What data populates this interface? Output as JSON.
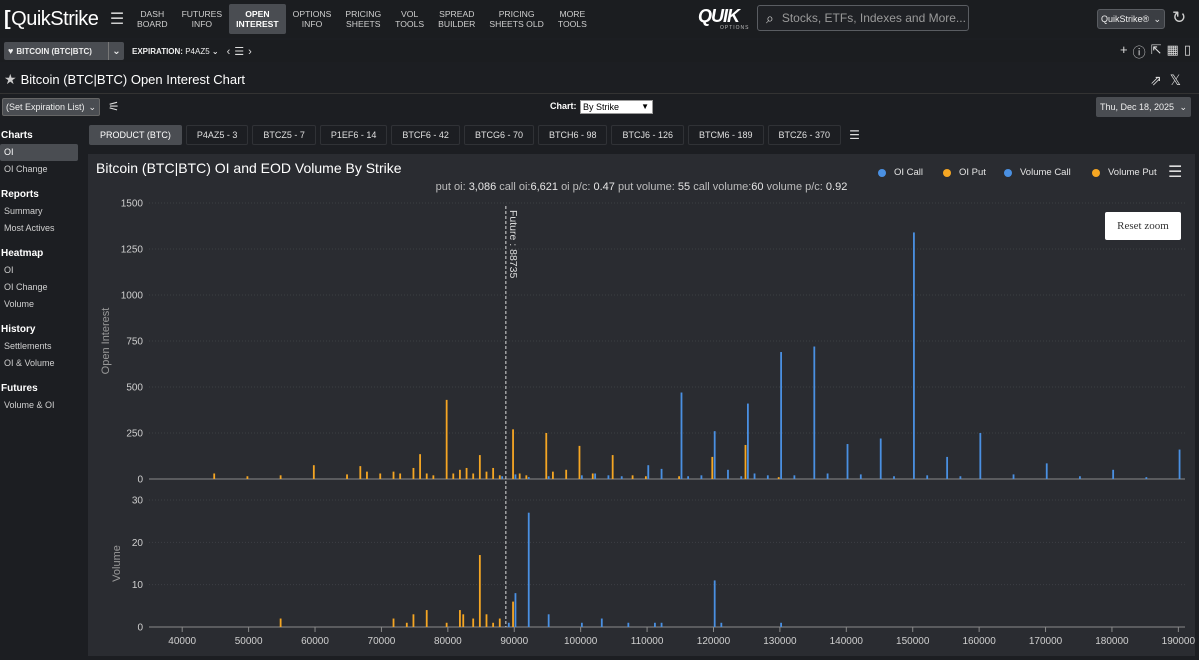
{
  "app": {
    "logo": "QuikStrike",
    "nav": [
      {
        "line1": "DASH",
        "line2": "BOARD"
      },
      {
        "line1": "FUTURES",
        "line2": "INFO"
      },
      {
        "line1": "OPEN",
        "line2": "INTEREST"
      },
      {
        "line1": "OPTIONS",
        "line2": "INFO"
      },
      {
        "line1": "PRICING",
        "line2": "SHEETS"
      },
      {
        "line1": "VOL",
        "line2": "TOOLS"
      },
      {
        "line1": "SPREAD",
        "line2": "BUILDER"
      },
      {
        "line1": "PRICING",
        "line2": "SHEETS OLD"
      },
      {
        "line1": "MORE",
        "line2": "TOOLS"
      }
    ],
    "active_nav_index": 2,
    "brand_logo": "QUIK",
    "brand_logo_sub": "OPTIONS",
    "search_placeholder": "Stocks, ETFs, Indexes and More...",
    "user_menu": "QuikStrike®"
  },
  "subbar": {
    "product": "BITCOIN (BTC|BTC)",
    "expiration_label": "EXPIRATION:",
    "expiration_value": "P4AZ5"
  },
  "page": {
    "title": "Bitcoin (BTC|BTC) Open Interest Chart"
  },
  "controls": {
    "expiration_list": "(Set Expiration List)",
    "chart_label": "Chart:",
    "chart_value": "By Strike",
    "date": "Thu, Dec 18, 2025"
  },
  "sidebar": [
    {
      "heading": "Charts",
      "items": [
        "OI",
        "OI Change"
      ]
    },
    {
      "heading": "Reports",
      "items": [
        "Summary",
        "Most Actives"
      ]
    },
    {
      "heading": "Heatmap",
      "items": [
        "OI",
        "OI Change",
        "Volume"
      ]
    },
    {
      "heading": "History",
      "items": [
        "Settlements",
        "OI & Volume"
      ]
    },
    {
      "heading": "Futures",
      "items": [
        "Volume & OI"
      ]
    }
  ],
  "tabs": [
    "PRODUCT (BTC)",
    "P4AZ5 - 3",
    "BTCZ5 - 7",
    "P1EF6 - 14",
    "BTCF6 - 42",
    "BTCG6 - 70",
    "BTCH6 - 98",
    "BTCJ6 - 126",
    "BTCM6 - 189",
    "BTCZ6 - 370"
  ],
  "chart_panel": {
    "reset_zoom": "Reset zoom",
    "stats": {
      "put_oi_label": "put oi:",
      "put_oi": "3,086",
      "call_oi_label": "call oi:",
      "call_oi": "6,621",
      "oi_pc_label": "oi p/c:",
      "oi_pc": "0.47",
      "put_vol_label": "put volume:",
      "put_vol": "55",
      "call_vol_label": "call volume:",
      "call_vol": "60",
      "vol_pc_label": "volume p/c:",
      "vol_pc": "0.92"
    }
  },
  "chart_data": {
    "type": "bar",
    "title": "Bitcoin (BTC|BTC) OI and EOD Volume By Strike",
    "legend": [
      {
        "name": "OI Call",
        "color": "#4a90e2"
      },
      {
        "name": "OI Put",
        "color": "#f5a623"
      },
      {
        "name": "Volume Call",
        "color": "#4a90e2"
      },
      {
        "name": "Volume Put",
        "color": "#f5a623"
      }
    ],
    "legend_placement": "top-right",
    "xlim": [
      35000,
      191000
    ],
    "xticks": [
      40000,
      50000,
      60000,
      70000,
      80000,
      90000,
      100000,
      110000,
      120000,
      130000,
      140000,
      150000,
      160000,
      170000,
      180000,
      190000
    ],
    "future_line": {
      "x": 88735,
      "label": "Future : 88735"
    },
    "oi_panel": {
      "ylabel": "Open Interest",
      "ylim": [
        0,
        1500
      ],
      "yticks": [
        0,
        250,
        500,
        750,
        1000,
        1250,
        1500
      ],
      "put": [
        [
          45000,
          30
        ],
        [
          50000,
          15
        ],
        [
          55000,
          20
        ],
        [
          60000,
          75
        ],
        [
          65000,
          25
        ],
        [
          67000,
          70
        ],
        [
          68000,
          40
        ],
        [
          70000,
          30
        ],
        [
          72000,
          40
        ],
        [
          73000,
          30
        ],
        [
          75000,
          60
        ],
        [
          76000,
          135
        ],
        [
          77000,
          30
        ],
        [
          78000,
          20
        ],
        [
          80000,
          430
        ],
        [
          81000,
          30
        ],
        [
          82000,
          50
        ],
        [
          83000,
          60
        ],
        [
          84000,
          30
        ],
        [
          85000,
          130
        ],
        [
          86000,
          40
        ],
        [
          87000,
          60
        ],
        [
          88000,
          20
        ],
        [
          90000,
          270
        ],
        [
          91000,
          30
        ],
        [
          92000,
          20
        ],
        [
          95000,
          250
        ],
        [
          96000,
          40
        ],
        [
          98000,
          50
        ],
        [
          100000,
          180
        ],
        [
          102000,
          30
        ],
        [
          105000,
          130
        ],
        [
          108000,
          20
        ],
        [
          110000,
          15
        ],
        [
          115000,
          15
        ],
        [
          120000,
          120
        ],
        [
          125000,
          185
        ],
        [
          130000,
          10
        ]
      ],
      "call": [
        [
          88000,
          15
        ],
        [
          90000,
          25
        ],
        [
          92000,
          10
        ],
        [
          95000,
          15
        ],
        [
          100000,
          20
        ],
        [
          102000,
          30
        ],
        [
          104000,
          20
        ],
        [
          106000,
          15
        ],
        [
          110000,
          75
        ],
        [
          112000,
          55
        ],
        [
          115000,
          470
        ],
        [
          116000,
          15
        ],
        [
          118000,
          20
        ],
        [
          120000,
          260
        ],
        [
          122000,
          50
        ],
        [
          124000,
          15
        ],
        [
          125000,
          410
        ],
        [
          126000,
          30
        ],
        [
          128000,
          20
        ],
        [
          130000,
          690
        ],
        [
          132000,
          20
        ],
        [
          135000,
          720
        ],
        [
          137000,
          30
        ],
        [
          140000,
          190
        ],
        [
          142000,
          25
        ],
        [
          145000,
          220
        ],
        [
          147000,
          15
        ],
        [
          150000,
          1340
        ],
        [
          152000,
          20
        ],
        [
          155000,
          120
        ],
        [
          157000,
          15
        ],
        [
          160000,
          250
        ],
        [
          165000,
          25
        ],
        [
          170000,
          85
        ],
        [
          175000,
          15
        ],
        [
          180000,
          50
        ],
        [
          185000,
          10
        ],
        [
          190000,
          160
        ]
      ]
    },
    "volume_panel": {
      "ylabel": "Volume",
      "ylim": [
        0,
        30
      ],
      "yticks": [
        0,
        10,
        20,
        30
      ],
      "put": [
        [
          55000,
          2
        ],
        [
          72000,
          2
        ],
        [
          74000,
          1
        ],
        [
          75000,
          3
        ],
        [
          77000,
          4
        ],
        [
          80000,
          1
        ],
        [
          82000,
          4
        ],
        [
          82500,
          3
        ],
        [
          84000,
          2
        ],
        [
          85000,
          17
        ],
        [
          86000,
          3
        ],
        [
          87000,
          1
        ],
        [
          88000,
          2
        ],
        [
          90000,
          6
        ]
      ],
      "call": [
        [
          89000,
          1
        ],
        [
          90000,
          8
        ],
        [
          92000,
          27
        ],
        [
          95000,
          3
        ],
        [
          100000,
          1
        ],
        [
          103000,
          2
        ],
        [
          107000,
          1
        ],
        [
          111000,
          1
        ],
        [
          112000,
          1
        ],
        [
          120000,
          11
        ],
        [
          121000,
          1
        ],
        [
          130000,
          1
        ]
      ]
    }
  }
}
